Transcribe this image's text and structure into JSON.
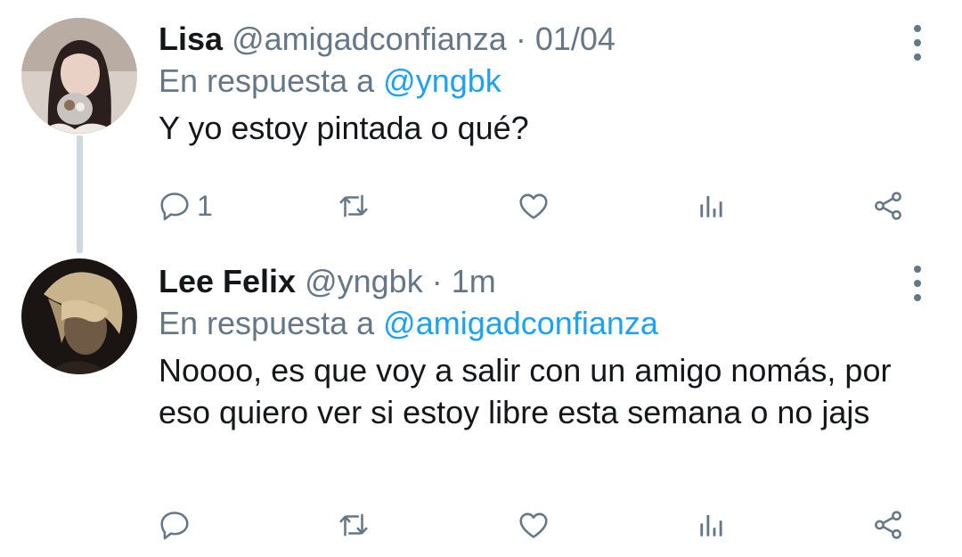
{
  "thread": [
    {
      "display_name": "Lisa",
      "handle": "@amigadconfianza",
      "separator": "·",
      "time": "01/04",
      "reply_prefix": "En respuesta a",
      "reply_to": "@yngbk",
      "text": "Y yo estoy pintada o qué?",
      "reply_count": "1"
    },
    {
      "display_name": "Lee Felix",
      "handle": "@yngbk",
      "separator": "·",
      "time": "1m",
      "reply_prefix": "En respuesta a",
      "reply_to": "@amigadconfianza",
      "text": "Noooo, es que voy a salir con un amigo nomás, por eso quiero ver si estoy libre esta semana o no jajs",
      "reply_count": ""
    }
  ],
  "icons": {
    "reply": "reply-icon",
    "retweet": "retweet-icon",
    "like": "heart-icon",
    "stats": "analytics-icon",
    "share": "share-icon",
    "more": "more-vertical-icon"
  },
  "colors": {
    "text_primary": "#14171a",
    "text_secondary": "#657786",
    "mention": "#1da1f2",
    "thread_line": "#cfd9de"
  }
}
